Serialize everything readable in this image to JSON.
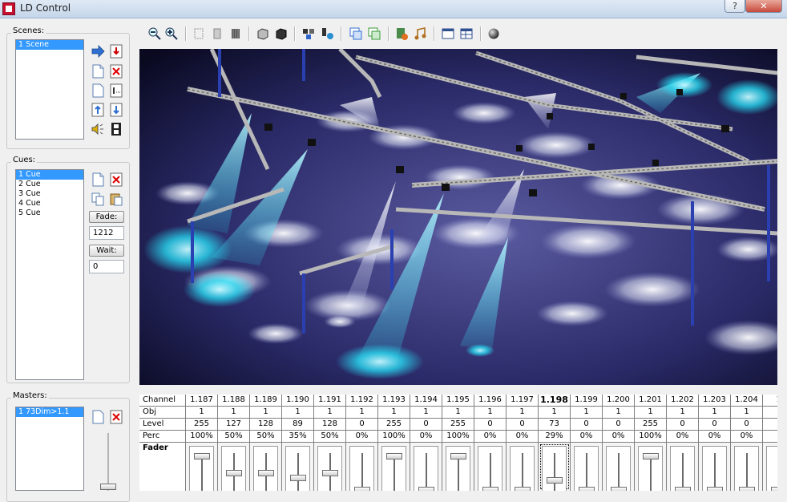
{
  "window": {
    "title": "LD Control",
    "help_label": "?",
    "close_label": "✕"
  },
  "scenes": {
    "label": "Scenes:",
    "items": [
      {
        "label": "1 Scene",
        "selected": true
      }
    ]
  },
  "cues": {
    "label": "Cues:",
    "items": [
      {
        "label": "1 Cue",
        "selected": true
      },
      {
        "label": "2 Cue",
        "selected": false
      },
      {
        "label": "3 Cue",
        "selected": false
      },
      {
        "label": "4 Cue",
        "selected": false
      },
      {
        "label": "5 Cue",
        "selected": false
      }
    ],
    "fade_label": "Fade:",
    "fade_value": "1212",
    "wait_label": "Wait:",
    "wait_value": "0"
  },
  "masters": {
    "label": "Masters:",
    "items": [
      {
        "label": "1 73Dim>1.1",
        "selected": true
      }
    ]
  },
  "toolbar": {
    "icons": [
      "zoom-out-icon",
      "zoom-in-icon",
      "select-icon",
      "frame-icon",
      "grid-icon",
      "box-wire-icon",
      "box-solid-icon",
      "fixture-select-icon",
      "fixture-group-icon",
      "window-restore-icon",
      "window-tile-icon",
      "cue-list-icon",
      "music-icon",
      "panel-icon",
      "table-icon",
      "sphere-icon"
    ]
  },
  "grid": {
    "row_labels": {
      "channel": "Channel",
      "obj": "Obj",
      "level": "Level",
      "perc": "Perc",
      "fader": "Fader"
    },
    "channels": [
      {
        "id": "1.187",
        "obj": "1",
        "level": "255",
        "perc": "100%",
        "fader": 1.0
      },
      {
        "id": "1.188",
        "obj": "1",
        "level": "127",
        "perc": "50%",
        "fader": 0.5
      },
      {
        "id": "1.189",
        "obj": "1",
        "level": "128",
        "perc": "50%",
        "fader": 0.5
      },
      {
        "id": "1.190",
        "obj": "1",
        "level": "89",
        "perc": "35%",
        "fader": 0.35
      },
      {
        "id": "1.191",
        "obj": "1",
        "level": "128",
        "perc": "50%",
        "fader": 0.5
      },
      {
        "id": "1.192",
        "obj": "1",
        "level": "0",
        "perc": "0%",
        "fader": 0
      },
      {
        "id": "1.193",
        "obj": "1",
        "level": "255",
        "perc": "100%",
        "fader": 1.0
      },
      {
        "id": "1.194",
        "obj": "1",
        "level": "0",
        "perc": "0%",
        "fader": 0
      },
      {
        "id": "1.195",
        "obj": "1",
        "level": "255",
        "perc": "100%",
        "fader": 1.0
      },
      {
        "id": "1.196",
        "obj": "1",
        "level": "0",
        "perc": "0%",
        "fader": 0
      },
      {
        "id": "1.197",
        "obj": "1",
        "level": "0",
        "perc": "0%",
        "fader": 0
      },
      {
        "id": "1.198",
        "obj": "1",
        "level": "73",
        "perc": "29%",
        "fader": 0.29,
        "selected": true
      },
      {
        "id": "1.199",
        "obj": "1",
        "level": "0",
        "perc": "0%",
        "fader": 0
      },
      {
        "id": "1.200",
        "obj": "1",
        "level": "0",
        "perc": "0%",
        "fader": 0
      },
      {
        "id": "1.201",
        "obj": "1",
        "level": "255",
        "perc": "100%",
        "fader": 1.0
      },
      {
        "id": "1.202",
        "obj": "1",
        "level": "0",
        "perc": "0%",
        "fader": 0
      },
      {
        "id": "1.203",
        "obj": "1",
        "level": "0",
        "perc": "0%",
        "fader": 0
      },
      {
        "id": "1.204",
        "obj": "1",
        "level": "0",
        "perc": "0%",
        "fader": 0
      },
      {
        "id": "1",
        "obj": "",
        "level": "",
        "perc": "",
        "fader": 0
      }
    ]
  },
  "colors": {
    "selection": "#3399ff",
    "beam_cyan": "#28d8f0",
    "stage_floor": "#3a3a78"
  }
}
